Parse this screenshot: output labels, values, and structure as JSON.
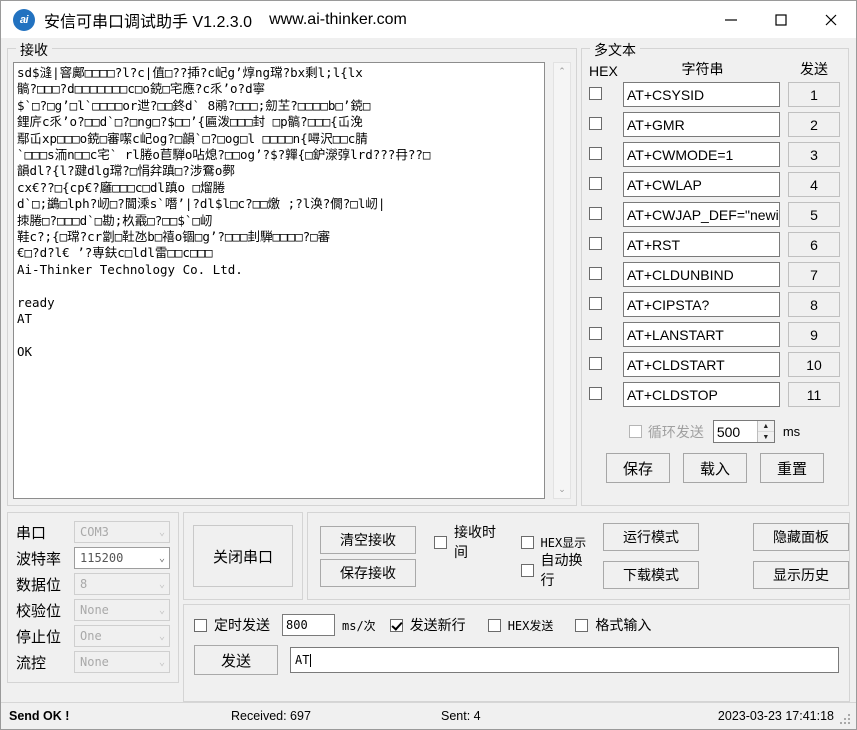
{
  "window": {
    "logo_text": "ai",
    "title": "安信可串口调试助手 V1.2.3.0",
    "url": "www.ai-thinker.com",
    "minimize_label": "—",
    "maximize_label": "□",
    "close_label": "✕"
  },
  "receive": {
    "group_label": "接收",
    "text": "sd$漨|窨鄺□□□□?l?c|值□??揷?c屺g’焞ng瑺?bx剩l;l{lx\n髇?□□□?d□□□□□□□c□o鋴□宅應?c乑’o?d寧\n$`□?□g’□l`□□□□or迣?□□鉖d` 8鹇?□□□;劎芏?□□□□b□’鋴□\n鋰庍c乑’o?□□d`□?□ng□?$□□’{匾泼□□□封 □p髇?□□□{屲浼\n鄢屲xp□□□o鋴□審噄c屺og?□韻`□?□og□l □□□□n{噚沢□□c腈\n`□□□s洏n□□c宅` rl腃o苣騨o呫熄?□□og’?$?嚲{□鈩濴弴lrd???冄??□\n韻dl?{l?踺dlg瑺?□悁弅蹎□?涉鴌o鄸\ncx€??□{cp€?廱□□□c□dl蹎o □熘腃\nd`□;鷁□lph?屻□?閫溗s`噆’|?dl$l□c?□□燩 ;?l涣?僩?□l屻|\n拺腃□?□□□d`□勘;杦霵□?□□$`□屻\n鞋c?;{□瑺?cr劏□靯氹b□禧o锢□g’?□□□刲騨□□□□?□審\n€□?d?l€ ’?専鈇c□ldl雷□□c□□□\nAi-Thinker Technology Co. Ltd.\n\nready\nAT\n\nOK",
    "scroll_up": "⌃",
    "scroll_down": "⌄"
  },
  "multitext": {
    "group_label": "多文本",
    "col_hex": "HEX",
    "col_string": "字符串",
    "col_send": "发送",
    "rows": [
      {
        "checked": false,
        "command": "AT+CSYSID",
        "button": "1"
      },
      {
        "checked": false,
        "command": "AT+GMR",
        "button": "2"
      },
      {
        "checked": false,
        "command": "AT+CWMODE=1",
        "button": "3"
      },
      {
        "checked": false,
        "command": "AT+CWLAP",
        "button": "4"
      },
      {
        "checked": false,
        "command": "AT+CWJAP_DEF=\"newifi_",
        "button": "5"
      },
      {
        "checked": false,
        "command": "AT+RST",
        "button": "6"
      },
      {
        "checked": false,
        "command": "AT+CLDUNBIND",
        "button": "7"
      },
      {
        "checked": false,
        "command": "AT+CIPSTA?",
        "button": "8"
      },
      {
        "checked": false,
        "command": "AT+LANSTART",
        "button": "9"
      },
      {
        "checked": false,
        "command": "AT+CLDSTART",
        "button": "10"
      },
      {
        "checked": false,
        "command": "AT+CLDSTOP",
        "button": "11"
      }
    ],
    "loop_send_label": "循环发送",
    "loop_send_checked": false,
    "loop_interval": "500",
    "loop_unit": "ms",
    "spin_up": "▲",
    "spin_down": "▼",
    "save_label": "保存",
    "load_label": "载入",
    "reset_label": "重置"
  },
  "serial": {
    "rows": [
      {
        "label": "串口",
        "value": "COM3",
        "enabled": false
      },
      {
        "label": "波特率",
        "value": "115200",
        "enabled": true
      },
      {
        "label": "数据位",
        "value": "8",
        "enabled": false
      },
      {
        "label": "校验位",
        "value": "None",
        "enabled": false
      },
      {
        "label": "停止位",
        "value": "One",
        "enabled": false
      },
      {
        "label": "流控",
        "value": "None",
        "enabled": false
      }
    ],
    "chevron": "⌄"
  },
  "controls": {
    "close_port": "关闭串口",
    "clear_receive": "清空接收",
    "save_receive": "保存接收",
    "recv_time_label": "接收时间",
    "recv_time_checked": false,
    "hex_display_label": "HEX显示",
    "hex_display_checked": false,
    "auto_wrap_label": "自动换行",
    "auto_wrap_checked": false,
    "run_mode": "运行模式",
    "download_mode": "下载模式",
    "hide_panel": "隐藏面板",
    "show_history": "显示历史"
  },
  "send": {
    "timed_send_label": "定时发送",
    "timed_send_checked": false,
    "interval_value": "800",
    "interval_unit": "ms/次",
    "newline_label": "发送新行",
    "newline_checked": true,
    "hex_send_label": "HEX发送",
    "hex_send_checked": false,
    "format_input_label": "格式输入",
    "format_input_checked": false,
    "send_button": "发送",
    "input_value": "AT"
  },
  "status": {
    "message": "Send OK !",
    "received": "Received: 697",
    "sent": "Sent: 4",
    "datetime": "2023-03-23 17:41:18"
  }
}
